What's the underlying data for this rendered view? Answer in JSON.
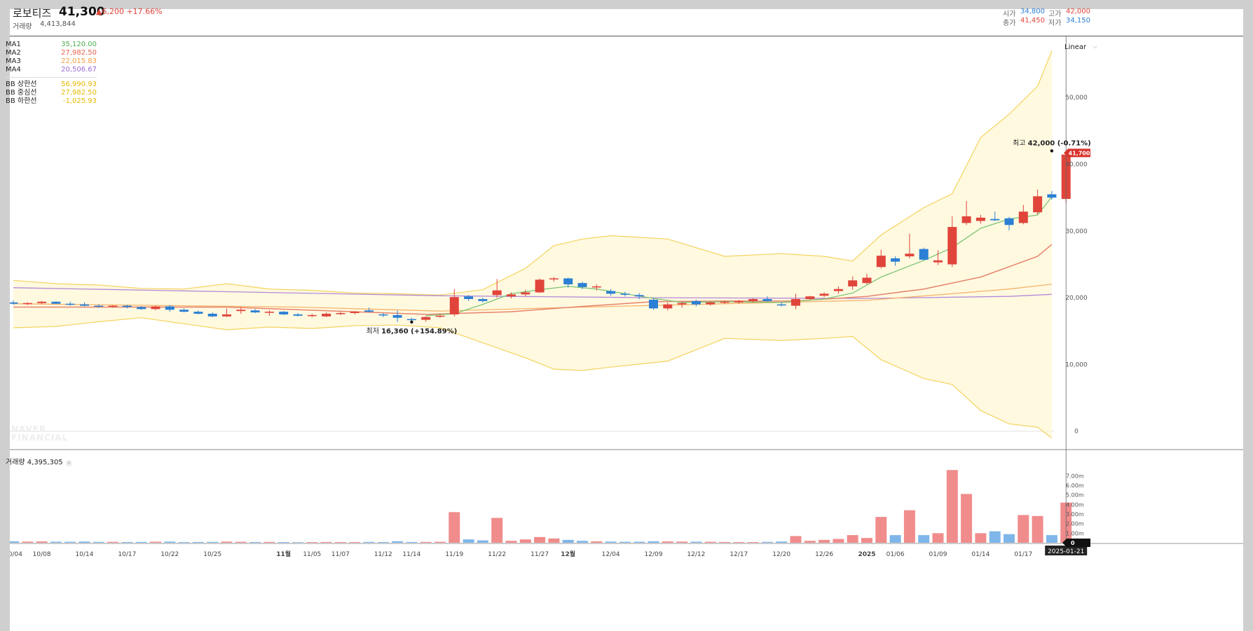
{
  "header": {
    "name": "로보티즈",
    "price": "41,300",
    "change": "▲6,200 +17.66%",
    "volume_label": "거래량",
    "volume": "4,413,844",
    "open_label": "시가",
    "open": "34,800",
    "high_label": "고가",
    "high": "42,000",
    "close_label": "종가",
    "close": "41,450",
    "low_label": "저가",
    "low": "34,150"
  },
  "scale_select": "Linear",
  "indicators": {
    "ma": [
      {
        "name": "MA1",
        "value": "35,120.00",
        "color": "#4caf50"
      },
      {
        "name": "MA2",
        "value": "27,982.50",
        "color": "#e8604c"
      },
      {
        "name": "MA3",
        "value": "22,015.83",
        "color": "#f39c43"
      },
      {
        "name": "MA4",
        "value": "20,506.67",
        "color": "#9c6ad6"
      }
    ],
    "bb": [
      {
        "name": "BB 상한선",
        "value": "56,990.93",
        "color": "#f1c40f"
      },
      {
        "name": "BB 중심선",
        "value": "27,982.50",
        "color": "#f1c40f"
      },
      {
        "name": "BB 하한선",
        "value": "-1,025.93",
        "color": "#f1c40f"
      }
    ]
  },
  "volume_panel": {
    "label": "거래량 4,395,305"
  },
  "watermark": "NAVER FINANCIAL",
  "colors": {
    "up": "#e0443a",
    "down": "#2b7fd4",
    "vol_up": "#f08c8c",
    "vol_down": "#7fb6ea",
    "band": "#f1c40f"
  },
  "chart_data": {
    "type": "candlestick",
    "price_axis": {
      "ticks": [
        "50,000",
        "40,000",
        "30,000",
        "20,000",
        "10,000",
        "0"
      ],
      "range": [
        -1500,
        58000
      ]
    },
    "volume_axis": {
      "ticks": [
        "7.00m",
        "6.00m",
        "5.00m",
        "4.00m",
        "3.00m",
        "2.00m",
        "1.00m",
        "0"
      ],
      "range": [
        0,
        8200000
      ]
    },
    "current_price_tag": "41,700",
    "current_volume_tag": "0",
    "crosshair_date": "2025-01-21",
    "x_ticks": [
      {
        "label": "10/04",
        "i": 0
      },
      {
        "label": "10/08",
        "i": 2
      },
      {
        "label": "10/14",
        "i": 5
      },
      {
        "label": "10/17",
        "i": 8
      },
      {
        "label": "10/22",
        "i": 11
      },
      {
        "label": "10/25",
        "i": 14
      },
      {
        "label": "11월",
        "i": 19,
        "bold": true
      },
      {
        "label": "11/05",
        "i": 21
      },
      {
        "label": "11/07",
        "i": 23
      },
      {
        "label": "11/12",
        "i": 26
      },
      {
        "label": "11/14",
        "i": 28
      },
      {
        "label": "11/19",
        "i": 31
      },
      {
        "label": "11/22",
        "i": 34
      },
      {
        "label": "11/27",
        "i": 37
      },
      {
        "label": "12월",
        "i": 39,
        "bold": true
      },
      {
        "label": "12/04",
        "i": 42
      },
      {
        "label": "12/09",
        "i": 45
      },
      {
        "label": "12/12",
        "i": 48
      },
      {
        "label": "12/17",
        "i": 51
      },
      {
        "label": "12/20",
        "i": 54
      },
      {
        "label": "12/26",
        "i": 57
      },
      {
        "label": "2025",
        "i": 60,
        "bold": true
      },
      {
        "label": "01/06",
        "i": 62
      },
      {
        "label": "01/09",
        "i": 65
      },
      {
        "label": "01/14",
        "i": 68
      },
      {
        "label": "01/17",
        "i": 71
      }
    ],
    "annotations": [
      {
        "label": "최저",
        "text": "16,360 (+154.89%)",
        "i": 28,
        "price": 16360,
        "pos": "below"
      },
      {
        "label": "최고",
        "text": "42,000 (-0.71%)",
        "i": 73,
        "price": 42000,
        "pos": "above"
      }
    ],
    "candles": [
      [
        19300,
        19600,
        18950,
        19100,
        150000
      ],
      [
        19100,
        19350,
        18900,
        19200,
        120000
      ],
      [
        19200,
        19500,
        19000,
        19400,
        140000
      ],
      [
        19400,
        19450,
        19050,
        19100,
        110000
      ],
      [
        19100,
        19400,
        18800,
        19000,
        100000
      ],
      [
        19000,
        19300,
        18700,
        18800,
        130000
      ],
      [
        18800,
        19000,
        18500,
        18700,
        90000
      ],
      [
        18700,
        18900,
        18500,
        18800,
        95000
      ],
      [
        18800,
        18950,
        18400,
        18600,
        80000
      ],
      [
        18600,
        18750,
        18200,
        18300,
        85000
      ],
      [
        18300,
        18800,
        18100,
        18700,
        110000
      ],
      [
        18700,
        18900,
        17900,
        18200,
        120000
      ],
      [
        18200,
        18400,
        17800,
        17900,
        70000
      ],
      [
        17900,
        18100,
        17500,
        17600,
        80000
      ],
      [
        17600,
        17800,
        17100,
        17200,
        90000
      ],
      [
        17200,
        18400,
        17100,
        17500,
        120000
      ],
      [
        18000,
        18600,
        17600,
        18200,
        100000
      ],
      [
        18100,
        18300,
        17700,
        17800,
        80000
      ],
      [
        17800,
        18100,
        17300,
        17900,
        90000
      ],
      [
        17900,
        18000,
        17400,
        17500,
        70000
      ],
      [
        17500,
        17700,
        17200,
        17300,
        60000
      ],
      [
        17300,
        17600,
        17100,
        17400,
        70000
      ],
      [
        17200,
        17800,
        17100,
        17600,
        80000
      ],
      [
        17600,
        17900,
        17400,
        17700,
        75000
      ],
      [
        17700,
        18000,
        17500,
        17900,
        70000
      ],
      [
        18100,
        18500,
        17800,
        17900,
        90000
      ],
      [
        17500,
        17700,
        17100,
        17400,
        75000
      ],
      [
        17400,
        18100,
        16360,
        17000,
        160000
      ],
      [
        16800,
        17000,
        16500,
        16700,
        80000
      ],
      [
        16700,
        17200,
        16400,
        17100,
        90000
      ],
      [
        17200,
        17500,
        17000,
        17300,
        100000
      ],
      [
        17500,
        21300,
        17200,
        20100,
        3200000
      ],
      [
        20200,
        20400,
        19500,
        19800,
        350000
      ],
      [
        19800,
        20000,
        19300,
        19500,
        250000
      ],
      [
        20400,
        22800,
        20000,
        21100,
        2600000
      ],
      [
        20200,
        20800,
        19900,
        20500,
        200000
      ],
      [
        20500,
        21200,
        20200,
        20800,
        350000
      ],
      [
        20800,
        22900,
        20700,
        22700,
        600000
      ],
      [
        22900,
        23100,
        22400,
        22900,
        450000
      ],
      [
        22900,
        23000,
        21500,
        22000,
        300000
      ],
      [
        22200,
        22400,
        21300,
        21600,
        200000
      ],
      [
        21600,
        22000,
        21100,
        21700,
        150000
      ],
      [
        21000,
        21300,
        20300,
        20600,
        120000
      ],
      [
        20600,
        20900,
        20200,
        20500,
        100000
      ],
      [
        20400,
        20700,
        19800,
        20200,
        110000
      ],
      [
        19700,
        19900,
        18200,
        18400,
        150000
      ],
      [
        18400,
        19300,
        18100,
        19000,
        140000
      ],
      [
        19000,
        19400,
        18500,
        19200,
        120000
      ],
      [
        19500,
        19700,
        18700,
        19000,
        110000
      ],
      [
        19000,
        19400,
        18800,
        19300,
        100000
      ],
      [
        19300,
        19600,
        19100,
        19400,
        80000
      ],
      [
        19300,
        19700,
        19100,
        19500,
        75000
      ],
      [
        19500,
        19900,
        19300,
        19800,
        70000
      ],
      [
        19800,
        20200,
        19400,
        19500,
        90000
      ],
      [
        19000,
        19300,
        18700,
        18900,
        130000
      ],
      [
        18800,
        20600,
        18300,
        19800,
        700000
      ],
      [
        19800,
        20300,
        19700,
        20200,
        200000
      ],
      [
        20300,
        20800,
        20100,
        20600,
        300000
      ],
      [
        21000,
        21700,
        20600,
        21300,
        400000
      ],
      [
        21700,
        23200,
        21200,
        22600,
        800000
      ],
      [
        22200,
        23600,
        22000,
        23000,
        500000
      ],
      [
        24600,
        27200,
        24400,
        26300,
        2700000
      ],
      [
        25900,
        26200,
        24800,
        25400,
        800000
      ],
      [
        26200,
        29600,
        25900,
        26600,
        3400000
      ],
      [
        27300,
        27500,
        25600,
        25700,
        800000
      ],
      [
        25300,
        27100,
        24900,
        25600,
        1000000
      ],
      [
        25000,
        32200,
        24600,
        30600,
        7600000
      ],
      [
        31200,
        34500,
        30900,
        32200,
        5100000
      ],
      [
        31500,
        32400,
        31100,
        32000,
        1000000
      ],
      [
        31800,
        32900,
        31500,
        31600,
        1200000
      ],
      [
        31900,
        32100,
        30100,
        30900,
        900000
      ],
      [
        31200,
        33900,
        31000,
        32900,
        2900000
      ],
      [
        32800,
        36200,
        32500,
        35200,
        2800000
      ],
      [
        35500,
        36000,
        34700,
        35000,
        800000
      ],
      [
        34800,
        42000,
        34150,
        41450,
        4200000
      ]
    ],
    "bb_upper": [
      [
        0,
        22600
      ],
      [
        3,
        22100
      ],
      [
        6,
        21900
      ],
      [
        9,
        21400
      ],
      [
        12,
        21300
      ],
      [
        15,
        22100
      ],
      [
        18,
        21300
      ],
      [
        21,
        21100
      ],
      [
        24,
        20700
      ],
      [
        27,
        20600
      ],
      [
        30,
        20400
      ],
      [
        33,
        21200
      ],
      [
        36,
        24400
      ],
      [
        38,
        27800
      ],
      [
        40,
        28800
      ],
      [
        42,
        29300
      ],
      [
        46,
        28800
      ],
      [
        50,
        26200
      ],
      [
        54,
        26600
      ],
      [
        57,
        26200
      ],
      [
        59,
        25500
      ],
      [
        61,
        29400
      ],
      [
        64,
        33500
      ],
      [
        66,
        35600
      ],
      [
        68,
        44000
      ],
      [
        70,
        47500
      ],
      [
        72,
        51700
      ],
      [
        73,
        56990
      ]
    ],
    "bb_lower": [
      [
        0,
        15500
      ],
      [
        3,
        15700
      ],
      [
        6,
        16400
      ],
      [
        9,
        17000
      ],
      [
        12,
        16100
      ],
      [
        15,
        15200
      ],
      [
        18,
        15600
      ],
      [
        21,
        15400
      ],
      [
        24,
        15800
      ],
      [
        27,
        15900
      ],
      [
        30,
        15500
      ],
      [
        32,
        14000
      ],
      [
        36,
        11000
      ],
      [
        38,
        9300
      ],
      [
        40,
        9100
      ],
      [
        42,
        9600
      ],
      [
        46,
        10500
      ],
      [
        50,
        13900
      ],
      [
        54,
        13600
      ],
      [
        57,
        13900
      ],
      [
        59,
        14200
      ],
      [
        61,
        10700
      ],
      [
        64,
        7900
      ],
      [
        66,
        7000
      ],
      [
        68,
        3100
      ],
      [
        70,
        1100
      ],
      [
        72,
        600
      ],
      [
        73,
        -1025
      ]
    ],
    "ma1": [
      [
        29,
        17300
      ],
      [
        31,
        17600
      ],
      [
        33,
        19000
      ],
      [
        35,
        20600
      ],
      [
        37,
        21200
      ],
      [
        39,
        21700
      ],
      [
        41,
        21300
      ],
      [
        43,
        20600
      ],
      [
        45,
        19900
      ],
      [
        47,
        19300
      ],
      [
        50,
        19400
      ],
      [
        54,
        19300
      ],
      [
        57,
        19800
      ],
      [
        59,
        20700
      ],
      [
        61,
        23100
      ],
      [
        64,
        25600
      ],
      [
        66,
        27500
      ],
      [
        68,
        30400
      ],
      [
        70,
        31800
      ],
      [
        72,
        32400
      ],
      [
        73,
        35120
      ]
    ],
    "ma2": [
      [
        0,
        18600
      ],
      [
        15,
        18600
      ],
      [
        29,
        17500
      ],
      [
        35,
        17900
      ],
      [
        40,
        18700
      ],
      [
        45,
        19400
      ],
      [
        50,
        19500
      ],
      [
        55,
        19500
      ],
      [
        60,
        20200
      ],
      [
        64,
        21300
      ],
      [
        68,
        23100
      ],
      [
        72,
        26200
      ],
      [
        73,
        27982
      ]
    ],
    "ma3": [
      [
        0,
        19100
      ],
      [
        20,
        18600
      ],
      [
        30,
        18000
      ],
      [
        40,
        18600
      ],
      [
        50,
        19100
      ],
      [
        60,
        19600
      ],
      [
        66,
        20600
      ],
      [
        70,
        21300
      ],
      [
        73,
        22015
      ]
    ],
    "ma4": [
      [
        0,
        21500
      ],
      [
        15,
        20900
      ],
      [
        30,
        20300
      ],
      [
        45,
        20000
      ],
      [
        60,
        19900
      ],
      [
        70,
        20200
      ],
      [
        73,
        20506
      ]
    ]
  }
}
